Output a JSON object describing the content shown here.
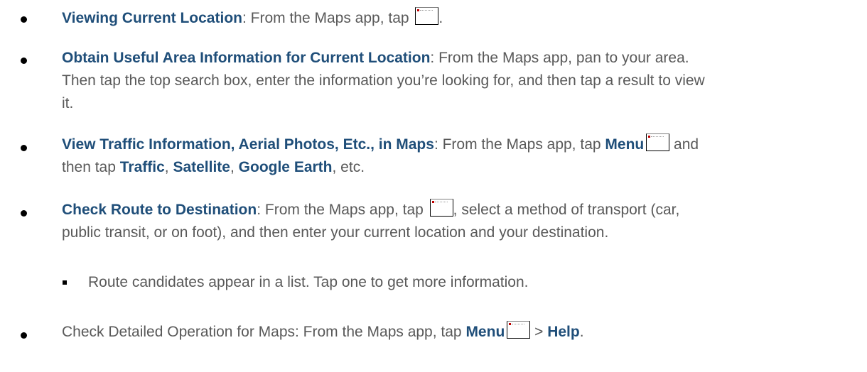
{
  "items": [
    {
      "title": "Viewing Current Location",
      "text_1": ": From the Maps app, tap ",
      "icon": "my-location-icon",
      "text_2": "."
    },
    {
      "title": "Obtain Useful Area Information for Current Location",
      "line1_rest": ": From the Maps app, pan to your area.",
      "line2": "Then tap the top search box, enter the information you’re looking for, and then tap a result to view",
      "line3": "it."
    },
    {
      "title": "View Traffic Information, Aerial Photos, Etc., in Maps",
      "text_1": ": From the Maps app, tap ",
      "menu_label": "Menu",
      "icon": "menu-icon",
      "text_2": " and",
      "line2_pre": "then tap ",
      "traffic": "Traffic",
      "sep1": ", ",
      "satellite": "Satellite",
      "sep2": ", ",
      "google_earth": "Google Earth",
      "line2_post": ", etc."
    },
    {
      "title": "Check Route to Destination",
      "text_1": ": From the Maps app, tap ",
      "icon": "directions-icon",
      "text_2": ", select a method of transport (car,",
      "line2": "public transit, or on foot), and then enter your current location and your destination.",
      "sub_item": "Route candidates appear in a list. Tap one to get more information."
    },
    {
      "text_1": "Check Detailed Operation for Maps: From the Maps app, tap ",
      "menu_label": "Menu",
      "icon": "menu-icon",
      "text_2": " > ",
      "help_label": "Help",
      "text_3": "."
    }
  ]
}
